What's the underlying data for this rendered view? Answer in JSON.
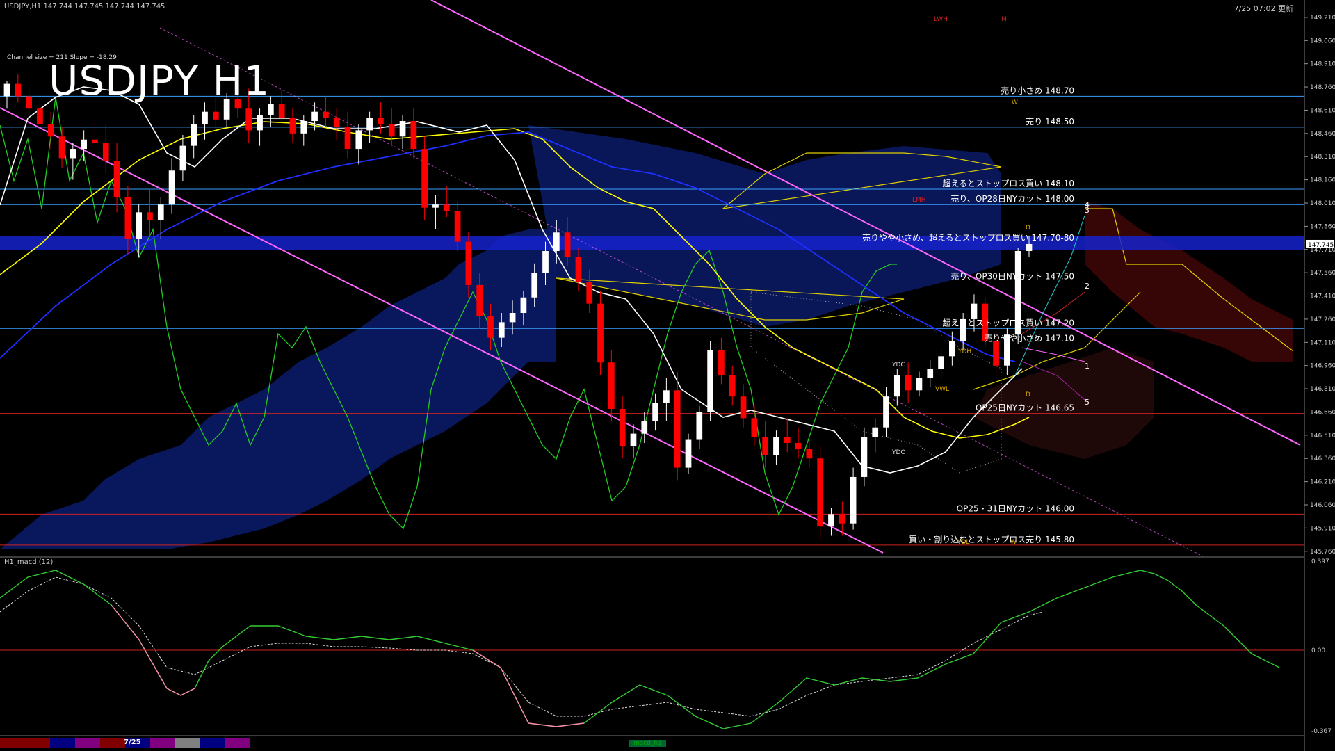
{
  "header": {
    "symbol_info": "USDJPY,H1  147.744 147.745 147.744 147.745",
    "timestamp": "7/25 07:02 更新",
    "title": "USDJPY H1",
    "channel_info": "Channel size = 211  Slope = -18.29"
  },
  "macd_panel": {
    "label": "H1_macd (12)",
    "badge": "macd_h1"
  },
  "bottom": {
    "date_tag": "7/25",
    "bar_colors": [
      "#800000",
      "#800000",
      "#000080",
      "#800080",
      "#800000",
      "#000080",
      "#800080",
      "#808080",
      "#000080",
      "#800080"
    ]
  },
  "colors": {
    "background": "#000000",
    "bull_candle": "#ffffff",
    "bear_candle": "#ff0000",
    "sma_white": "#ffffff",
    "sma_yellow": "#ffff00",
    "sma_blue": "#1e2fff",
    "channel": "#ff66ff",
    "chikou": "#22cc22",
    "level_blue": "#3aa0ff",
    "level_red": "#cc2222"
  },
  "chart_data": {
    "type": "candlestick",
    "symbol": "USDJPY",
    "timeframe": "H1",
    "ylim": [
      145.75,
      149.25
    ],
    "y_ticks": [
      149.21,
      149.06,
      148.91,
      148.76,
      148.61,
      148.46,
      148.31,
      148.16,
      148.01,
      147.86,
      147.71,
      147.56,
      147.41,
      147.26,
      147.11,
      146.96,
      146.81,
      146.66,
      146.51,
      146.36,
      146.21,
      146.06,
      145.91,
      145.76
    ],
    "current_price": "147.745",
    "levels": [
      {
        "price": 148.7,
        "label": "売り小さめ 148.70",
        "color": "#3aa0ff"
      },
      {
        "price": 148.5,
        "label": "売り 148.50",
        "color": "#3aa0ff"
      },
      {
        "price": 148.1,
        "label": "超えるとストップロス買い 148.10",
        "color": "#3aa0ff"
      },
      {
        "price": 148.0,
        "label": "売り、OP28日NYカット 148.00",
        "color": "#3aa0ff"
      },
      {
        "price": 147.75,
        "label": "売りやや小さめ、超えるとストップロス買い 147.70-80",
        "color": "#2030ff"
      },
      {
        "price": 147.5,
        "label": "売り、OP30日NYカット 147.50",
        "color": "#3aa0ff"
      },
      {
        "price": 147.2,
        "label": "超えるとストップロス買い 147.20",
        "color": "#3aa0ff"
      },
      {
        "price": 147.1,
        "label": "売りやや小さめ 147.10",
        "color": "#3aa0ff"
      },
      {
        "price": 146.65,
        "label": "OP25日NYカット 146.65",
        "color": "#cc2222"
      },
      {
        "price": 146.0,
        "label": "OP25・31日NYカット 146.00",
        "color": "#cc2222"
      },
      {
        "price": 145.8,
        "label": "買い・割り込むとストップロス売り 145.80",
        "color": "#cc2222"
      }
    ],
    "box_labels": [
      "LWH",
      "M",
      "W",
      "LMH",
      "D",
      "YDC",
      "YDH",
      "YDO",
      "YDL",
      "D",
      "W",
      "VWL"
    ],
    "wave_labels": [
      "1",
      "2",
      "3",
      "4",
      "5"
    ],
    "candles": [
      [
        148.7,
        148.8,
        148.62,
        148.78
      ],
      [
        148.78,
        148.84,
        148.66,
        148.7
      ],
      [
        148.7,
        148.76,
        148.58,
        148.62
      ],
      [
        148.62,
        148.7,
        148.48,
        148.52
      ],
      [
        148.52,
        148.6,
        148.36,
        148.44
      ],
      [
        148.44,
        148.5,
        148.24,
        148.3
      ],
      [
        148.3,
        148.4,
        148.16,
        148.36
      ],
      [
        148.36,
        148.48,
        148.28,
        148.42
      ],
      [
        148.42,
        148.55,
        148.32,
        148.4
      ],
      [
        148.4,
        148.52,
        148.2,
        148.28
      ],
      [
        148.28,
        148.4,
        147.95,
        148.05
      ],
      [
        148.05,
        148.12,
        147.68,
        147.78
      ],
      [
        147.78,
        148.0,
        147.66,
        147.95
      ],
      [
        147.95,
        148.1,
        147.8,
        147.9
      ],
      [
        147.9,
        148.05,
        147.78,
        148.0
      ],
      [
        148.0,
        148.3,
        147.94,
        148.22
      ],
      [
        148.22,
        148.45,
        148.15,
        148.38
      ],
      [
        148.38,
        148.58,
        148.3,
        148.52
      ],
      [
        148.52,
        148.66,
        148.42,
        148.6
      ],
      [
        148.6,
        148.7,
        148.48,
        148.55
      ],
      [
        148.55,
        148.72,
        148.5,
        148.68
      ],
      [
        148.68,
        148.8,
        148.56,
        148.62
      ],
      [
        148.62,
        148.75,
        148.4,
        148.48
      ],
      [
        148.48,
        148.62,
        148.38,
        148.58
      ],
      [
        148.58,
        148.7,
        148.5,
        148.65
      ],
      [
        148.65,
        148.74,
        148.52,
        148.56
      ],
      [
        148.56,
        148.62,
        148.4,
        148.46
      ],
      [
        148.46,
        148.58,
        148.38,
        148.54
      ],
      [
        148.54,
        148.66,
        148.48,
        148.6
      ],
      [
        148.6,
        148.7,
        148.5,
        148.56
      ],
      [
        148.56,
        148.62,
        148.42,
        148.5
      ],
      [
        148.5,
        148.6,
        148.3,
        148.36
      ],
      [
        148.36,
        148.52,
        148.26,
        148.48
      ],
      [
        148.48,
        148.6,
        148.4,
        148.56
      ],
      [
        148.56,
        148.66,
        148.46,
        148.52
      ],
      [
        148.52,
        148.62,
        148.38,
        148.44
      ],
      [
        148.44,
        148.58,
        148.36,
        148.54
      ],
      [
        148.54,
        148.62,
        148.3,
        148.36
      ],
      [
        148.36,
        148.44,
        147.9,
        147.98
      ],
      [
        147.98,
        148.06,
        147.84,
        148.0
      ],
      [
        148.0,
        148.12,
        147.92,
        147.96
      ],
      [
        147.96,
        148.02,
        147.7,
        147.76
      ],
      [
        147.76,
        147.82,
        147.4,
        147.48
      ],
      [
        147.48,
        147.56,
        147.2,
        147.28
      ],
      [
        147.28,
        147.36,
        147.06,
        147.14
      ],
      [
        147.14,
        147.3,
        147.08,
        147.24
      ],
      [
        147.24,
        147.38,
        147.16,
        147.3
      ],
      [
        147.3,
        147.44,
        147.22,
        147.4
      ],
      [
        147.4,
        147.62,
        147.34,
        147.56
      ],
      [
        147.56,
        147.76,
        147.48,
        147.7
      ],
      [
        147.7,
        147.9,
        147.62,
        147.82
      ],
      [
        147.82,
        147.92,
        147.6,
        147.66
      ],
      [
        147.66,
        147.72,
        147.44,
        147.5
      ],
      [
        147.5,
        147.58,
        147.3,
        147.36
      ],
      [
        147.36,
        147.44,
        146.9,
        146.98
      ],
      [
        146.98,
        147.06,
        146.6,
        146.68
      ],
      [
        146.68,
        146.76,
        146.36,
        146.44
      ],
      [
        146.44,
        146.58,
        146.36,
        146.52
      ],
      [
        146.52,
        146.66,
        146.46,
        146.6
      ],
      [
        146.6,
        146.78,
        146.54,
        146.72
      ],
      [
        146.72,
        146.88,
        146.6,
        146.8
      ],
      [
        146.8,
        146.92,
        146.22,
        146.3
      ],
      [
        146.3,
        146.52,
        146.26,
        146.48
      ],
      [
        146.48,
        146.7,
        146.42,
        146.66
      ],
      [
        146.66,
        147.12,
        146.6,
        147.06
      ],
      [
        147.06,
        147.14,
        146.84,
        146.9
      ],
      [
        146.9,
        146.96,
        146.7,
        146.76
      ],
      [
        146.76,
        146.84,
        146.56,
        146.62
      ],
      [
        146.62,
        146.7,
        146.44,
        146.5
      ],
      [
        146.5,
        146.6,
        146.3,
        146.38
      ],
      [
        146.38,
        146.54,
        146.32,
        146.5
      ],
      [
        146.5,
        146.62,
        146.4,
        146.46
      ],
      [
        146.46,
        146.56,
        146.36,
        146.42
      ],
      [
        146.42,
        146.52,
        146.3,
        146.36
      ],
      [
        146.36,
        146.44,
        145.84,
        145.92
      ],
      [
        145.92,
        146.04,
        145.86,
        146.0
      ],
      [
        146.0,
        146.08,
        145.86,
        145.94
      ],
      [
        145.94,
        146.3,
        145.9,
        146.24
      ],
      [
        146.24,
        146.56,
        146.18,
        146.5
      ],
      [
        146.5,
        146.62,
        146.4,
        146.56
      ],
      [
        146.56,
        146.82,
        146.5,
        146.76
      ],
      [
        146.76,
        146.94,
        146.7,
        146.9
      ],
      [
        146.9,
        146.98,
        146.72,
        146.8
      ],
      [
        146.8,
        146.92,
        146.76,
        146.88
      ],
      [
        146.88,
        147.0,
        146.82,
        146.94
      ],
      [
        146.94,
        147.06,
        146.88,
        147.02
      ],
      [
        147.02,
        147.18,
        146.96,
        147.12
      ],
      [
        147.12,
        147.3,
        147.06,
        147.26
      ],
      [
        147.26,
        147.42,
        147.18,
        147.36
      ],
      [
        147.36,
        147.4,
        147.08,
        147.12
      ],
      [
        147.12,
        147.2,
        146.88,
        146.96
      ],
      [
        146.96,
        147.2,
        146.9,
        147.16
      ],
      [
        147.16,
        147.72,
        147.1,
        147.7
      ],
      [
        147.7,
        147.8,
        147.66,
        147.745
      ]
    ]
  }
}
